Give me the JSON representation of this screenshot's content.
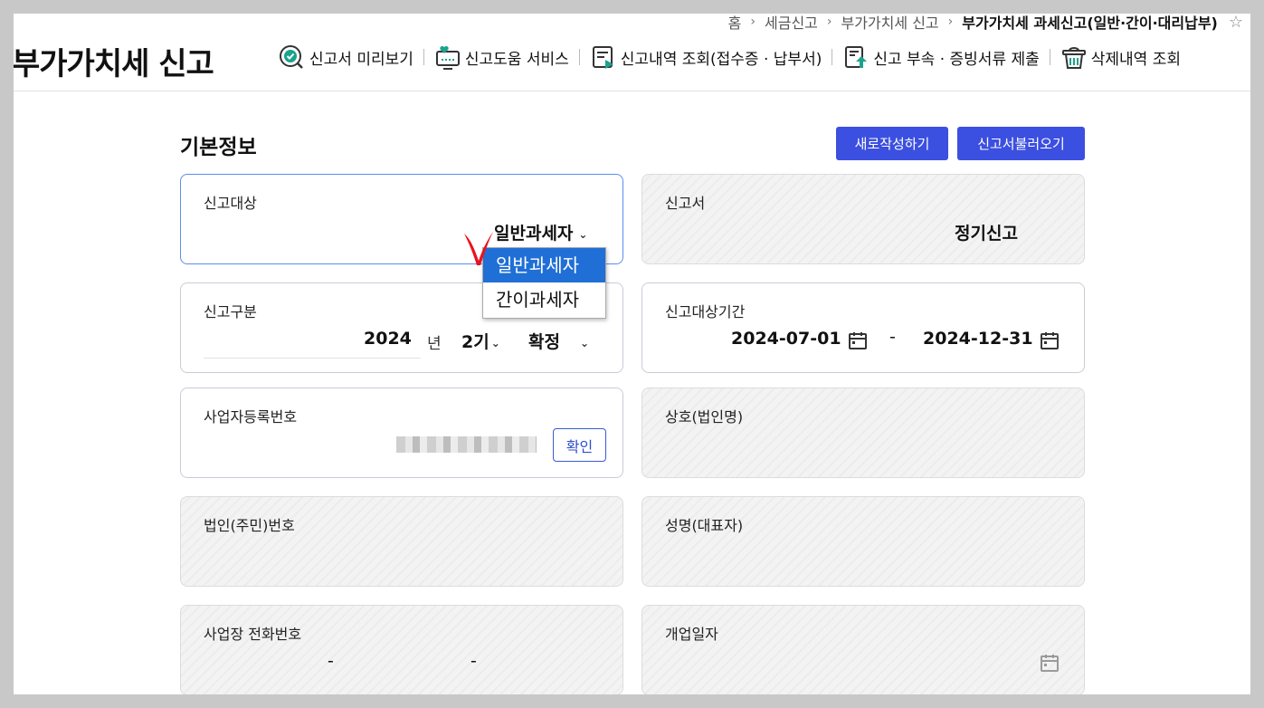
{
  "breadcrumb": {
    "home": "홈",
    "level1": "세금신고",
    "level2": "부가가치세 신고",
    "current": "부가가치세 과세신고(일반·간이·대리납부)",
    "favorite_icon": "star-icon"
  },
  "header": {
    "title": "부가가치세 신고",
    "nav": [
      {
        "label": "신고서 미리보기",
        "icon": "preview-check-icon"
      },
      {
        "label": "신고도움 서비스",
        "icon": "help-monitor-icon"
      },
      {
        "label": "신고내역 조회(접수증 · 납부서)",
        "icon": "history-doc-icon"
      },
      {
        "label": "신고 부속 · 증빙서류 제출",
        "icon": "upload-doc-icon"
      },
      {
        "label": "삭제내역 조회",
        "icon": "trash-icon"
      }
    ]
  },
  "main": {
    "section_title": "기본정보",
    "new_button": "새로작성하기",
    "load_button": "신고서불러오기",
    "fields": {
      "target": {
        "label": "신고대상",
        "value": "일반과세자"
      },
      "report": {
        "label": "신고서",
        "value": "정기신고"
      },
      "category": {
        "label": "신고구분",
        "year": "2024",
        "year_suffix": "년",
        "period": "2기",
        "type": "확정"
      },
      "period": {
        "label": "신고대상기간",
        "start": "2024-07-01",
        "separator": "-",
        "end": "2024-12-31"
      },
      "biz_no": {
        "label": "사업자등록번호",
        "confirm": "확인"
      },
      "company": {
        "label": "상호(법인명)"
      },
      "corp_no": {
        "label": "법인(주민)번호"
      },
      "ceo": {
        "label": "성명(대표자)"
      },
      "phone": {
        "label": "사업장 전화번호",
        "sep1": "-",
        "sep2": "-"
      },
      "open_date": {
        "label": "개업일자"
      }
    },
    "target_dropdown": {
      "options": [
        "일반과세자",
        "간이과세자"
      ],
      "selected": "일반과세자"
    }
  },
  "colors": {
    "primary": "#3b4fe0",
    "dropdown_selected": "#1f6fd6",
    "focus_border": "#5b8df0",
    "annotation": "#e8141c"
  }
}
